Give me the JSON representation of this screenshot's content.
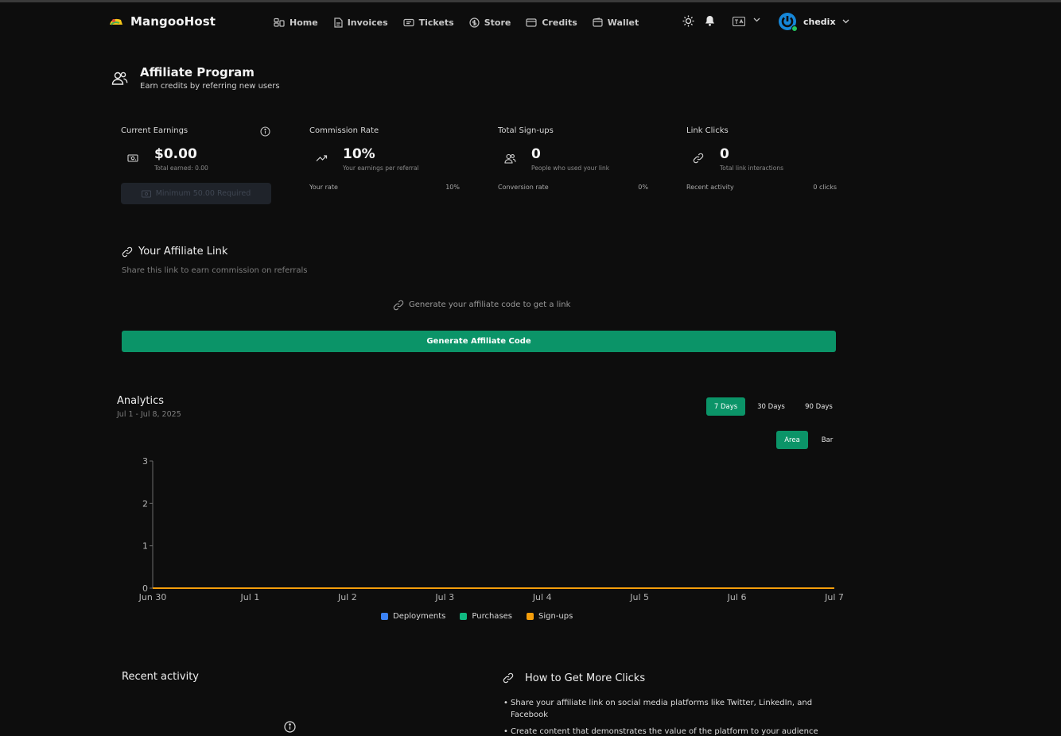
{
  "app": {
    "name": "MangooHost"
  },
  "nav": [
    {
      "label": "Home",
      "icon": "home-icon"
    },
    {
      "label": "Invoices",
      "icon": "invoice-icon"
    },
    {
      "label": "Tickets",
      "icon": "ticket-icon"
    },
    {
      "label": "Store",
      "icon": "store-icon"
    },
    {
      "label": "Credits",
      "icon": "credit-card-icon"
    },
    {
      "label": "Wallet",
      "icon": "wallet-icon"
    }
  ],
  "user": {
    "name": "chedix",
    "status_color": "#22c55e"
  },
  "page": {
    "title": "Affiliate Program",
    "subtitle": "Earn credits by referring new users"
  },
  "stats": {
    "earnings": {
      "title": "Current Earnings",
      "value": "$0.00",
      "sub": "Total earned: 0.00",
      "button": "Minimum 50.00 Required"
    },
    "commission": {
      "title": "Commission Rate",
      "value": "10%",
      "sub": "Your earnings per referral",
      "row_label": "Your rate",
      "row_value": "10%"
    },
    "signups": {
      "title": "Total Sign-ups",
      "value": "0",
      "sub": "People who used your link",
      "row_label": "Conversion rate",
      "row_value": "0%"
    },
    "clicks": {
      "title": "Link Clicks",
      "value": "0",
      "sub": "Total link interactions",
      "row_label": "Recent activity",
      "row_value": "0 clicks"
    }
  },
  "affiliate": {
    "title": "Your Affiliate Link",
    "subtitle": "Share this link to earn commission on referrals",
    "empty_text": "Generate your affiliate code to get a link",
    "button": "Generate Affiliate Code"
  },
  "analytics": {
    "title": "Analytics",
    "date_range": "Jul 1 - Jul 8, 2025",
    "ranges": [
      "7 Days",
      "30 Days",
      "90 Days"
    ],
    "active_range": "7 Days",
    "views": [
      "Area",
      "Bar"
    ],
    "active_view": "Area"
  },
  "chart_data": {
    "type": "area",
    "x": [
      "Jun 30",
      "Jul 1",
      "Jul 2",
      "Jul 3",
      "Jul 4",
      "Jul 5",
      "Jul 6",
      "Jul 7"
    ],
    "yticks": [
      0,
      1,
      2,
      3
    ],
    "ylim": [
      0,
      3
    ],
    "series": [
      {
        "name": "Deployments",
        "color": "#3b82f6",
        "values": [
          0,
          0,
          0,
          0,
          0,
          0,
          0,
          0
        ]
      },
      {
        "name": "Purchases",
        "color": "#10b981",
        "values": [
          0,
          0,
          0,
          0,
          0,
          0,
          0,
          0
        ]
      },
      {
        "name": "Sign-ups",
        "color": "#f59e0b",
        "values": [
          0,
          0,
          0,
          0,
          0,
          0,
          0,
          0
        ]
      }
    ],
    "legend_position": "bottom",
    "grid": false
  },
  "recent": {
    "title": "Recent activity"
  },
  "tips": {
    "title": "How to Get More Clicks",
    "items": [
      "Share your affiliate link on social media platforms like Twitter, LinkedIn, and Facebook",
      "Create content that demonstrates the value of the platform to your audience"
    ]
  }
}
